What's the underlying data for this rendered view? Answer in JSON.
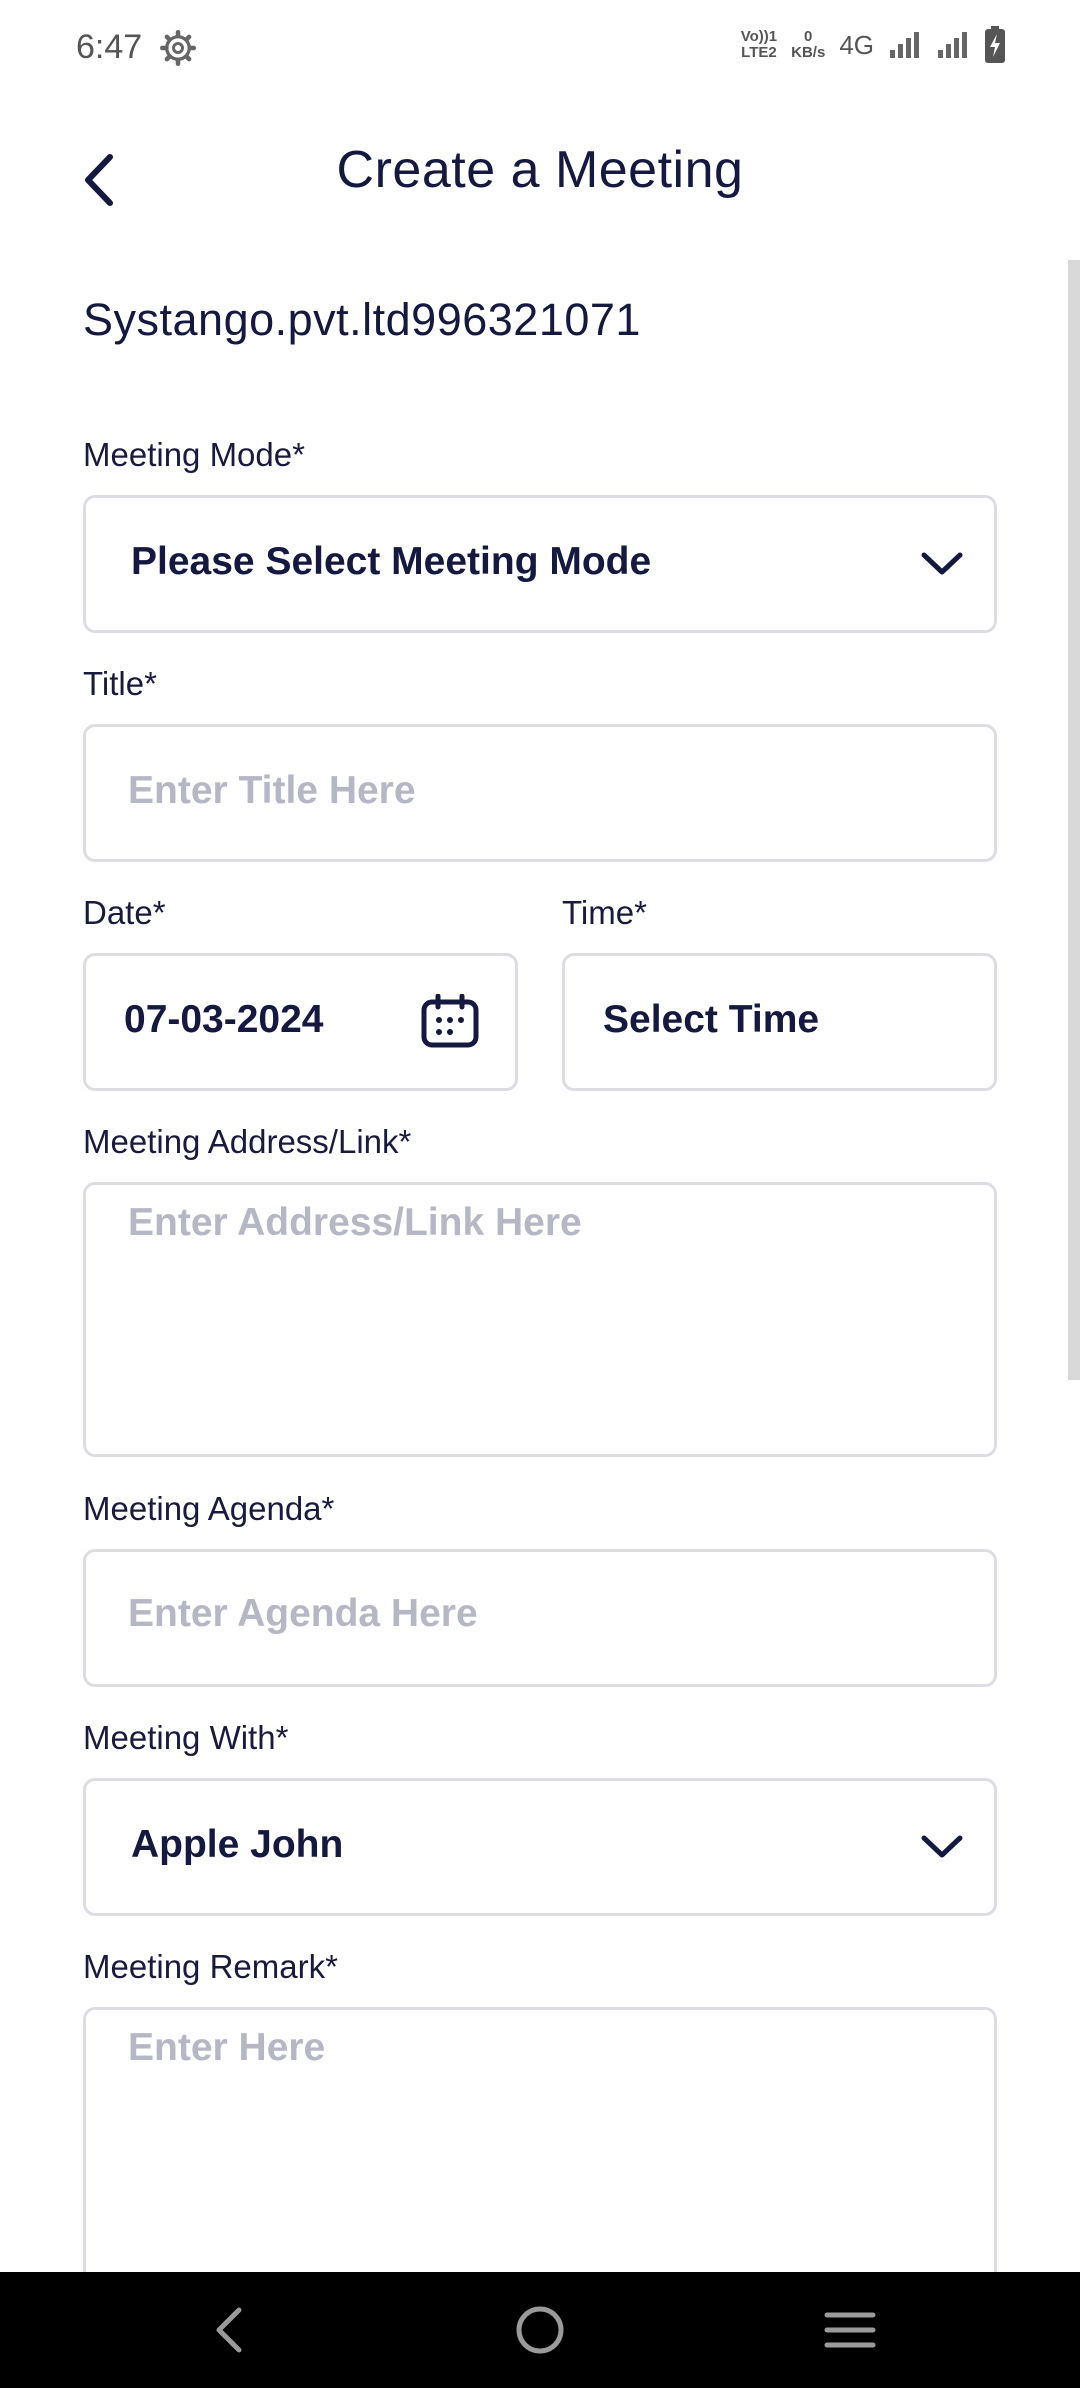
{
  "status_bar": {
    "time": "6:47",
    "volte_top": "Vo))1",
    "volte_bottom": "LTE2",
    "speed_top": "0",
    "speed_bottom": "KB/s",
    "network": "4G"
  },
  "header": {
    "title": "Create a Meeting"
  },
  "company": "Systango.pvt.ltd996321071",
  "form": {
    "meeting_mode": {
      "label": "Meeting Mode*",
      "value": "Please Select Meeting Mode"
    },
    "title": {
      "label": "Title*",
      "placeholder": "Enter Title Here"
    },
    "date": {
      "label": "Date*",
      "value": "07-03-2024"
    },
    "time": {
      "label": "Time*",
      "value": "Select Time"
    },
    "address": {
      "label": "Meeting Address/Link*",
      "placeholder": "Enter Address/Link Here"
    },
    "agenda": {
      "label": "Meeting Agenda*",
      "placeholder": "Enter Agenda Here"
    },
    "meeting_with": {
      "label": "Meeting With*",
      "value": "Apple John"
    },
    "remark": {
      "label": "Meeting Remark*",
      "placeholder": "Enter Here"
    }
  },
  "icons": {
    "back": "chevron-left-icon",
    "dropdown": "chevron-down-icon",
    "calendar": "calendar-icon",
    "settings": "gear-icon"
  },
  "colors": {
    "text_primary": "#15183f",
    "placeholder": "#b6b7c4",
    "border": "#dcdce2",
    "nav_bar": "#000000"
  }
}
